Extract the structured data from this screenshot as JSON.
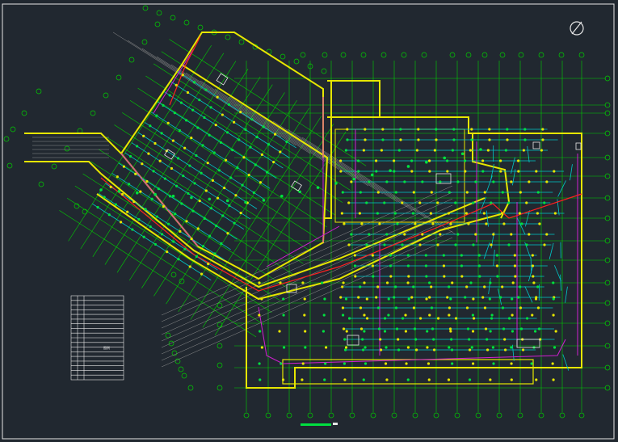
{
  "drawing": {
    "background": "#212830",
    "frame_color": "#e6e6e6",
    "layers": {
      "walls": "#e6e600",
      "sprinkler_branch": "#00c8c8",
      "sprinkler_main": "#d020d0",
      "heads": "#00e040",
      "axis": "#00d000",
      "hatch": "#909090",
      "fire_main": "#ff2020",
      "legend_line": "#e6e6e6"
    },
    "north_arrow": "north-arrow-icon",
    "legend": {
      "rows": 18,
      "caption": "图例"
    },
    "scale_bar": {
      "color": "#00e040"
    }
  }
}
